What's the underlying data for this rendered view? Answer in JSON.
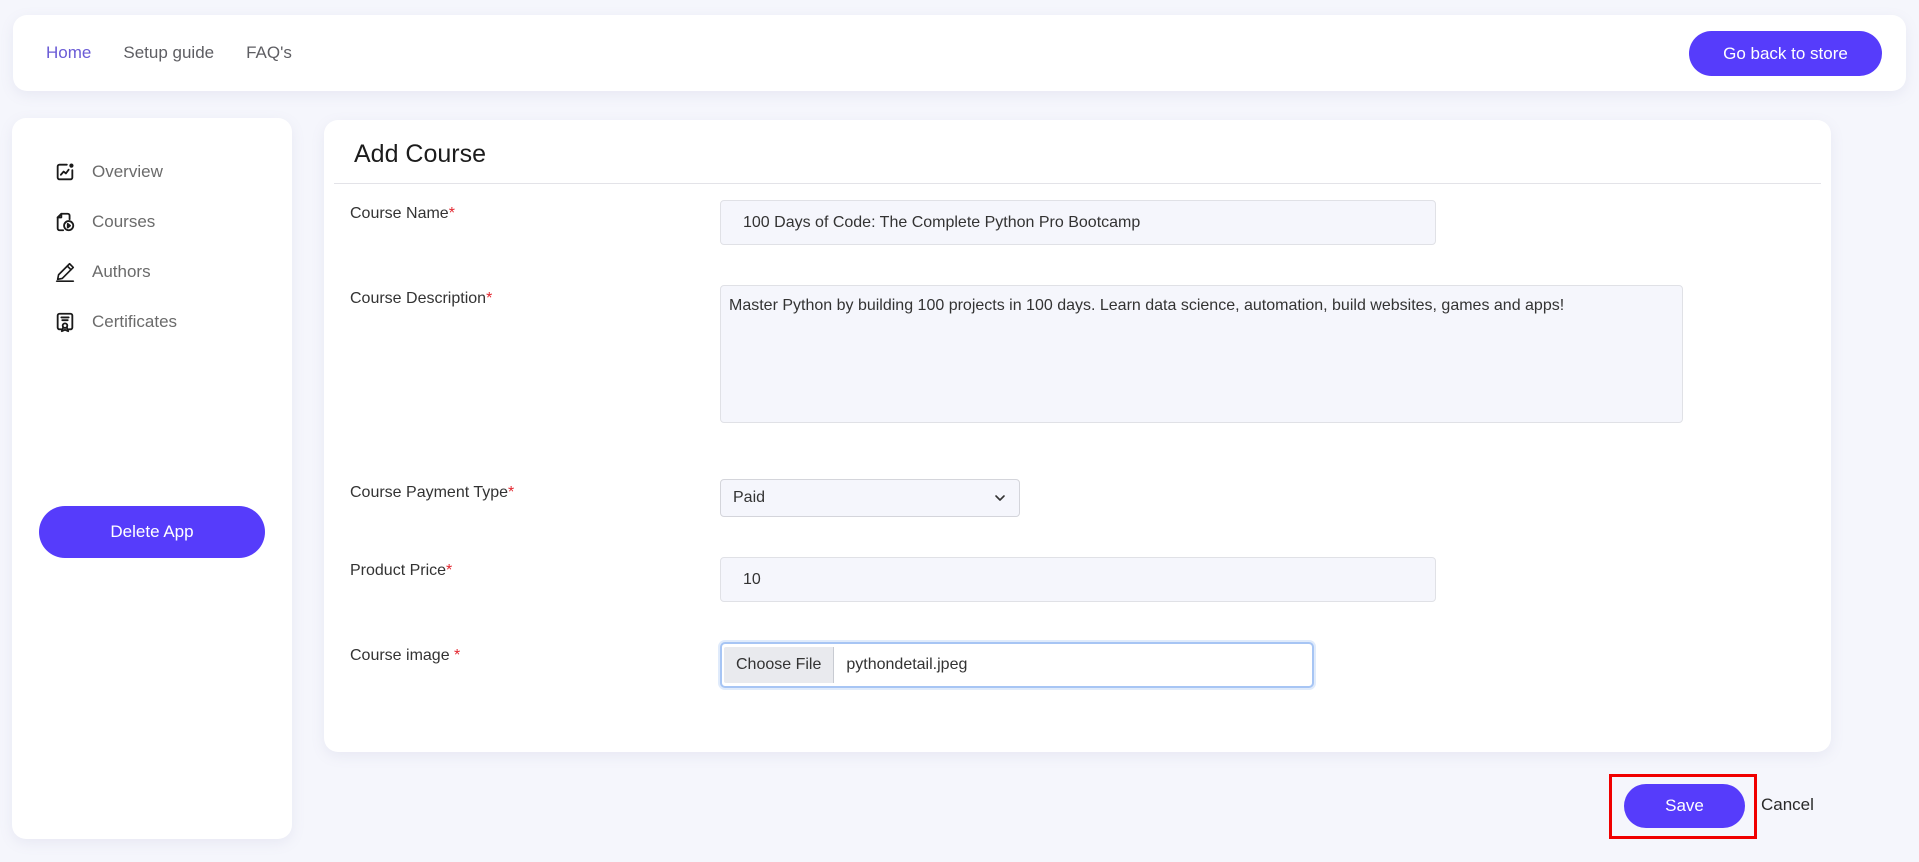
{
  "topnav": {
    "links": [
      {
        "label": "Home",
        "active": true
      },
      {
        "label": "Setup guide",
        "active": false
      },
      {
        "label": "FAQ's",
        "active": false
      }
    ],
    "store_button": "Go back to store"
  },
  "sidebar": {
    "items": [
      {
        "label": "Overview",
        "icon": "chart-square-icon"
      },
      {
        "label": "Courses",
        "icon": "course-file-play-icon"
      },
      {
        "label": "Authors",
        "icon": "pencil-icon"
      },
      {
        "label": "Certificates",
        "icon": "certificate-icon"
      }
    ],
    "delete_button": "Delete App"
  },
  "form": {
    "title": "Add Course",
    "course_name": {
      "label": "Course Name",
      "required_mark": "*",
      "value": "100 Days of Code: The Complete Python Pro Bootcamp"
    },
    "course_description": {
      "label": "Course Description",
      "required_mark": "*",
      "value": "Master Python by building 100 projects in 100 days. Learn data science, automation, build websites, games and apps!"
    },
    "payment_type": {
      "label": "Course Payment Type",
      "required_mark": "*",
      "value": "Paid"
    },
    "product_price": {
      "label": "Product Price",
      "required_mark": "*",
      "value": "10"
    },
    "course_image": {
      "label": "Course image ",
      "required_mark": "*",
      "button": "Choose File",
      "file_name": "pythondetail.jpeg"
    }
  },
  "actions": {
    "save": "Save",
    "cancel": "Cancel"
  },
  "colors": {
    "accent": "#563cfb",
    "active_link": "#6a5bd6",
    "required": "#e3262f",
    "highlight": "#f00000",
    "background": "#f5f6fc"
  }
}
